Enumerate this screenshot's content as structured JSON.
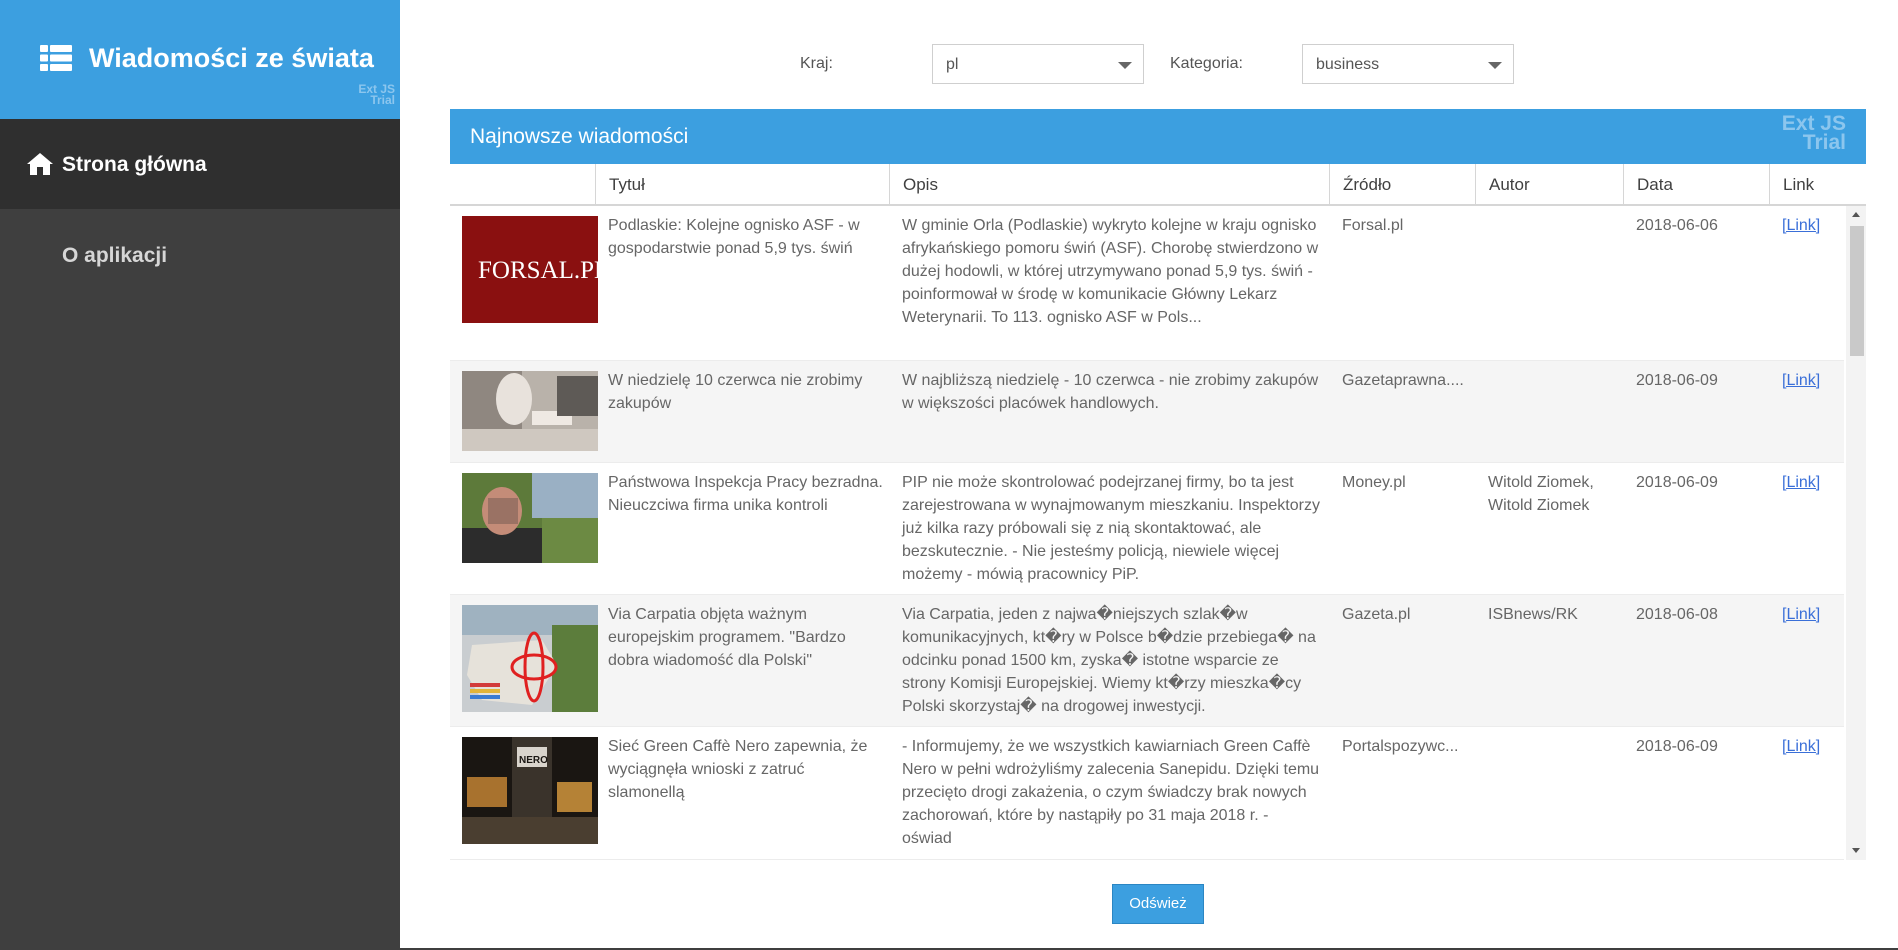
{
  "app": {
    "title": "Wiadomości ze świata",
    "trial_line1": "Ext JS",
    "trial_line2": "Trial"
  },
  "nav": [
    {
      "label": "Strona główna",
      "icon": "home-icon"
    },
    {
      "label": "O aplikacji"
    }
  ],
  "filters": {
    "country_label": "Kraj:",
    "country_value": "pl",
    "category_label": "Kategoria:",
    "category_value": "business"
  },
  "grid": {
    "title": "Najnowsze wiadomości",
    "trial_line1": "Ext JS",
    "trial_line2": "Trial",
    "columns": [
      "",
      "Tytuł",
      "Opis",
      "Źródło",
      "Autor",
      "Data",
      "Link"
    ],
    "rows": [
      {
        "title": "Podlaskie: Kolejne ognisko ASF - w gospodarstwie ponad 5,9 tys. świń",
        "desc": "W gminie Orla (Podlaskie) wykryto kolejne w kraju ognisko afrykańskiego pomoru świń (ASF). Chorobę stwierdzono w dużej hodowli, w której utrzymywano ponad 5,9 tys. świń - poinformował w środę w komunikacie Główny Lekarz Weterynarii. To 113. ognisko ASF w Pols...",
        "source": "Forsal.pl",
        "author": "",
        "date": "2018-06-06",
        "link": "[Link]",
        "thumb": "forsal",
        "thumb_text": "FORSAL.PL"
      },
      {
        "title": "W niedzielę 10 czerwca nie zrobimy zakupów",
        "desc": "W najbliższą niedzielę - 10 czerwca - nie zrobimy zakupów w większości placówek handlowych.",
        "source": "Gazetaprawna....",
        "author": "",
        "date": "2018-06-09",
        "link": "[Link]",
        "thumb": "shopping"
      },
      {
        "title": "Państwowa Inspekcja Pracy bezradna. Nieuczciwa firma unika kontroli",
        "desc": "PIP nie może skontrolować podejrzanej firmy, bo ta jest zarejestrowana w wynajmowanym mieszkaniu. Inspektorzy już kilka razy próbowali się z nią skontaktować, ale bezskutecznie. - Nie jesteśmy policją, niewiele więcej możemy - mówią pracownicy PiP.",
        "source": "Money.pl",
        "author": "Witold Ziomek, Witold Ziomek",
        "date": "2018-06-09",
        "link": "[Link]",
        "thumb": "man"
      },
      {
        "title": "Via Carpatia objęta ważnym europejskim programem. \"Bardzo dobra wiadomość dla Polski\"",
        "desc": "Via Carpatia, jeden z najwa�niejszych szlak�w komunikacyjnych, kt�ry w Polsce b�dzie przebiega� na odcinku ponad 1500 km, zyska� istotne wsparcie ze strony Komisji Europejskiej. Wiemy kt�rzy mieszka�cy Polski skorzystaj� na drogowej inwestycji.",
        "source": "Gazeta.pl",
        "author": "ISBnews/RK",
        "date": "2018-06-08",
        "link": "[Link]",
        "thumb": "map"
      },
      {
        "title": "Sieć Green Caffè Nero zapewnia, że wyciągnęła wnioski z zatruć slamonellą",
        "desc": "- Informujemy, że we wszystkich kawiarniach Green Caffè Nero w pełni wdrożyliśmy zalecenia Sanepidu. Dzięki temu przecięto drogi zakażenia, o czym świadczy brak nowych zachorowań, które by nastąpiły po 31 maja 2018 r. - oświad",
        "source": "Portalspozywc...",
        "author": "",
        "date": "2018-06-09",
        "link": "[Link]",
        "thumb": "cafe",
        "thumb_text": "NERO"
      }
    ]
  },
  "refresh_label": "Odśwież"
}
